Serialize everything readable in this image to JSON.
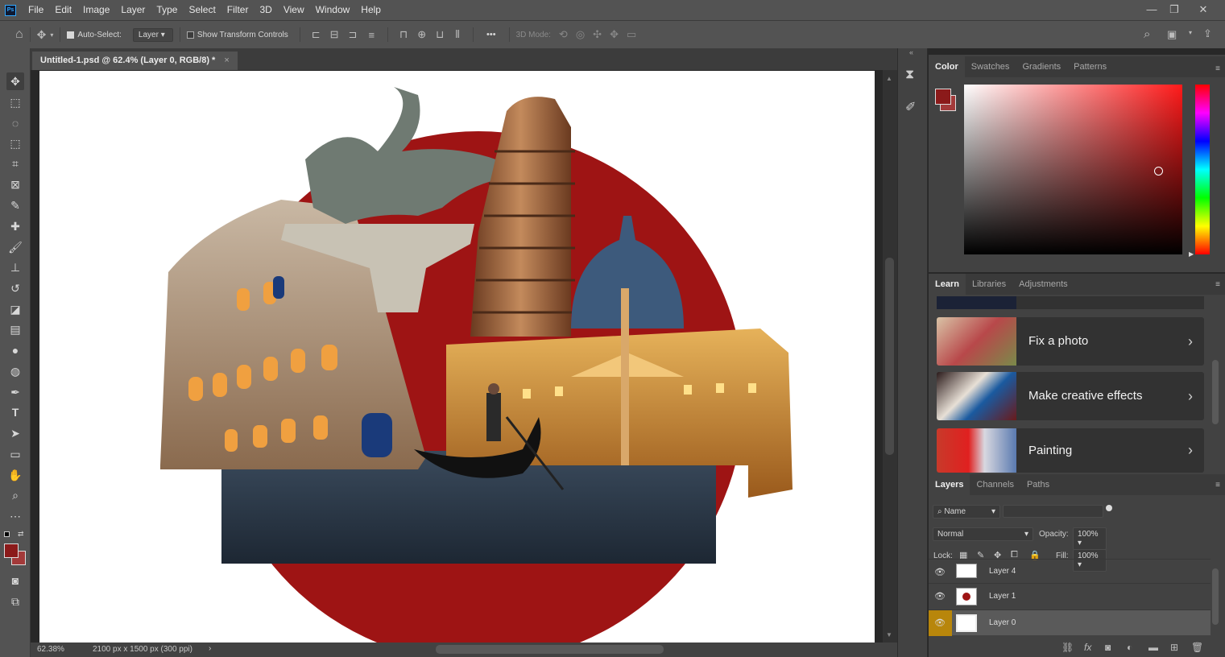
{
  "app": {
    "logo": "Ps"
  },
  "menu": [
    "File",
    "Edit",
    "Image",
    "Layer",
    "Type",
    "Select",
    "Filter",
    "3D",
    "View",
    "Window",
    "Help"
  ],
  "window_controls": {
    "minimize": "—",
    "restore": "❐",
    "close": "✕"
  },
  "options": {
    "auto_select_label": "Auto-Select:",
    "auto_select_checked": true,
    "auto_select_target": "Layer",
    "show_transform_label": "Show Transform Controls",
    "show_transform_checked": false,
    "more": "•••",
    "mode_3d_label": "3D Mode:"
  },
  "document": {
    "tab_title": "Untitled-1.psd @ 62.4% (Layer 0, RGB/8) *",
    "close": "×"
  },
  "status": {
    "zoom": "62.38%",
    "info": "2100 px x 1500 px (300 ppi)",
    "arrow": "›"
  },
  "colors": {
    "foreground": "#8b1a1a",
    "background": "#a33a3a",
    "accent": "#31a8ff",
    "artwork_circle": "#9e1414"
  },
  "color_panel": {
    "tabs": [
      "Color",
      "Swatches",
      "Gradients",
      "Patterns"
    ],
    "active_tab": "Color",
    "picker_hue": "#ff1a1a"
  },
  "learn_panel": {
    "tabs": [
      "Learn",
      "Libraries",
      "Adjustments"
    ],
    "active_tab": "Learn",
    "cards": [
      {
        "label": "Fix a photo",
        "icon": "chevron-right"
      },
      {
        "label": "Make creative effects",
        "icon": "chevron-right"
      },
      {
        "label": "Painting",
        "icon": "chevron-right"
      }
    ]
  },
  "layers_panel": {
    "tabs": [
      "Layers",
      "Channels",
      "Paths"
    ],
    "active_tab": "Layers",
    "filter_kind": "Name",
    "blend_mode": "Normal",
    "opacity_label": "Opacity:",
    "opacity": "100%",
    "lock_label": "Lock:",
    "fill_label": "Fill:",
    "fill": "100%",
    "layers": [
      {
        "name": "Layer 4",
        "visible": true,
        "selected": false
      },
      {
        "name": "Layer 1",
        "visible": true,
        "selected": false
      },
      {
        "name": "Layer 0",
        "visible": true,
        "selected": true
      }
    ]
  },
  "artwork": {
    "elements": [
      "winged-lion-statue",
      "leaning-tower",
      "colosseum",
      "st-peters-basilica",
      "gondola",
      "canal-water",
      "red-circle"
    ]
  }
}
